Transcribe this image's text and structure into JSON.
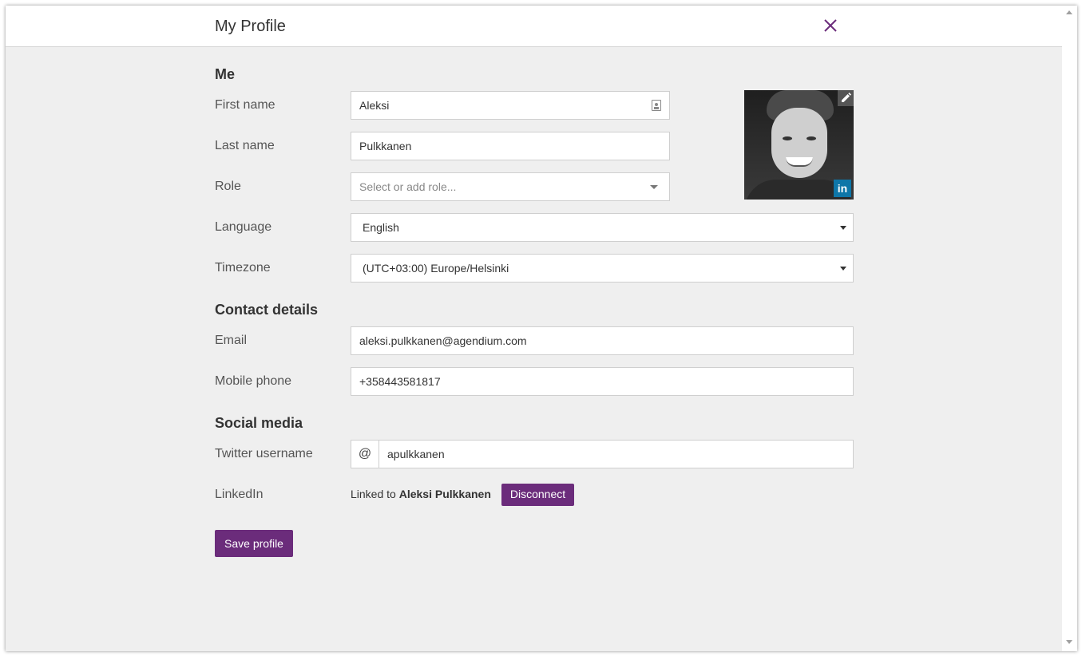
{
  "window": {
    "title": "My Profile"
  },
  "sections": {
    "me": "Me",
    "contact": "Contact details",
    "social": "Social media"
  },
  "fields": {
    "first_name": {
      "label": "First name",
      "value": "Aleksi"
    },
    "last_name": {
      "label": "Last name",
      "value": "Pulkkanen"
    },
    "role": {
      "label": "Role",
      "placeholder": "Select or add role..."
    },
    "language": {
      "label": "Language",
      "value": "English"
    },
    "timezone": {
      "label": "Timezone",
      "value": "(UTC+03:00) Europe/Helsinki"
    },
    "email": {
      "label": "Email",
      "value": "aleksi.pulkkanen@agendium.com"
    },
    "mobile": {
      "label": "Mobile phone",
      "value": "+358443581817"
    },
    "twitter": {
      "label": "Twitter username",
      "prefix": "@",
      "value": "apulkkanen"
    },
    "linkedin": {
      "label": "LinkedIn",
      "linked_prefix": "Linked to",
      "linked_name": "Aleksi Pulkkanen",
      "badge": "in"
    }
  },
  "buttons": {
    "disconnect": "Disconnect",
    "save": "Save profile"
  },
  "colors": {
    "accent": "#6b2c7b",
    "linkedin": "#0e76a8"
  },
  "icons": {
    "close": "close-icon",
    "edit": "pencil-icon",
    "contact": "contact-card-icon"
  }
}
